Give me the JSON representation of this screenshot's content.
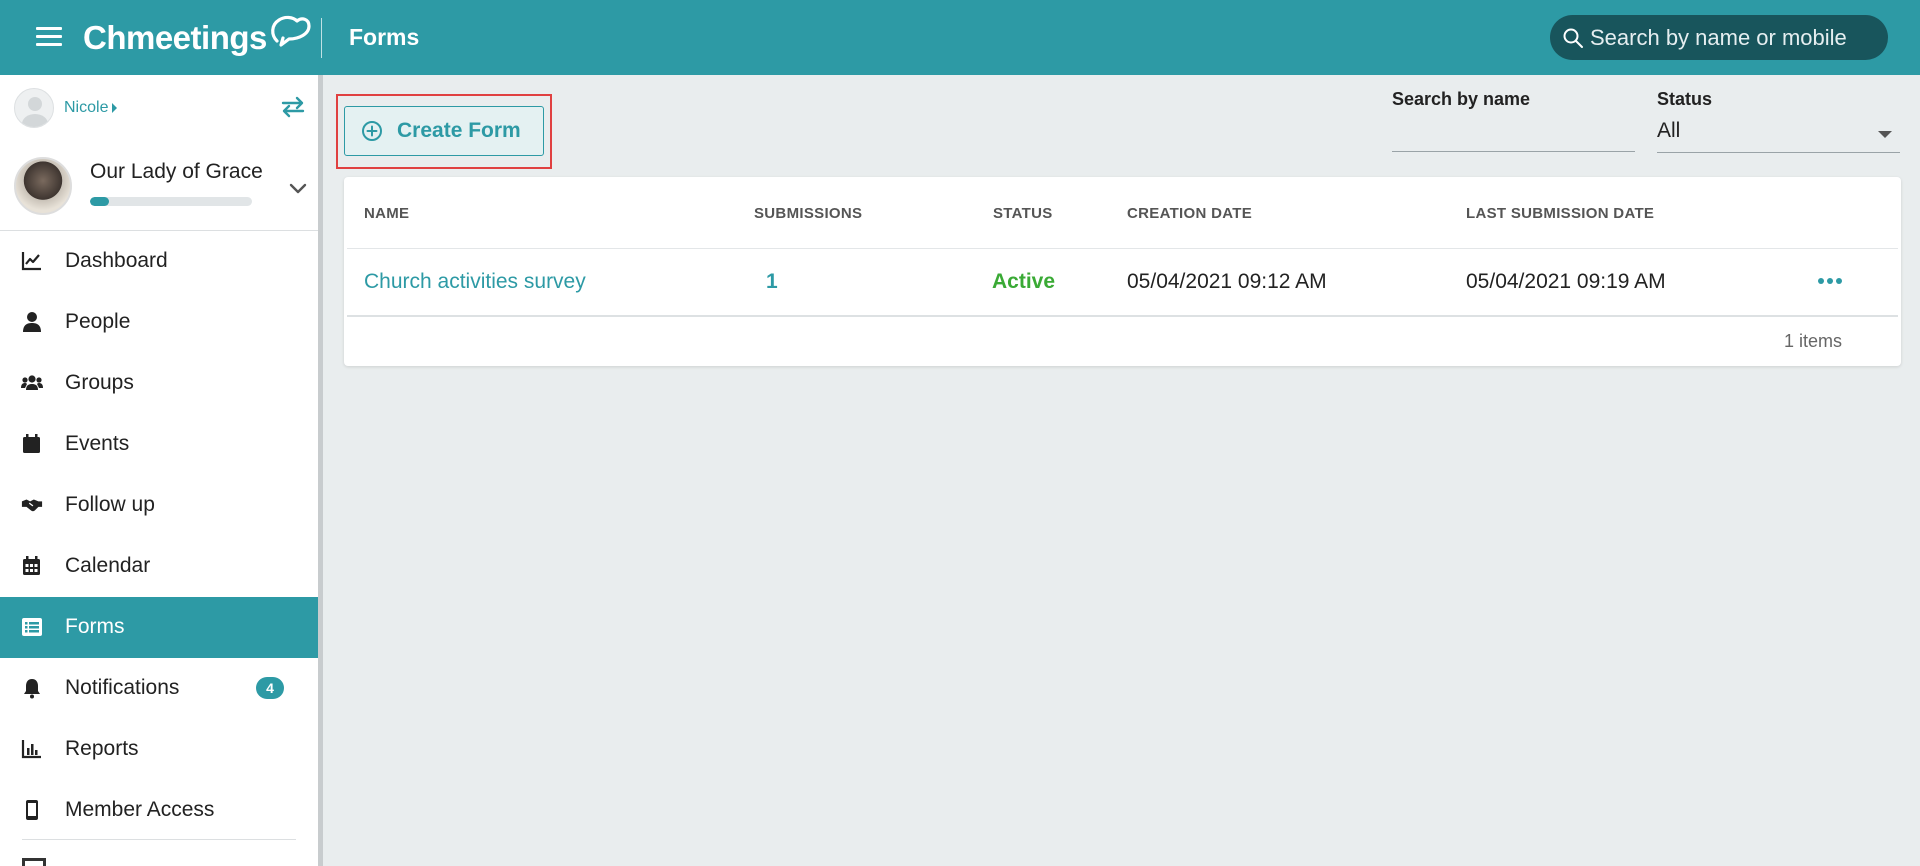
{
  "app": {
    "brand": "Chmeetings",
    "page_title": "Forms"
  },
  "global_search": {
    "placeholder": "Search by name or mobile"
  },
  "user": {
    "name": "Nicole"
  },
  "church": {
    "name": "Our Lady of Grace",
    "progress_fraction": 0.12
  },
  "sidebar": {
    "items": [
      {
        "label": "Dashboard",
        "icon": "chart-line-icon"
      },
      {
        "label": "People",
        "icon": "person-icon"
      },
      {
        "label": "Groups",
        "icon": "users-icon"
      },
      {
        "label": "Events",
        "icon": "calendar-day-icon"
      },
      {
        "label": "Follow up",
        "icon": "handshake-icon"
      },
      {
        "label": "Calendar",
        "icon": "calendar-grid-icon"
      },
      {
        "label": "Forms",
        "icon": "list-form-icon",
        "active": true
      },
      {
        "label": "Notifications",
        "icon": "bell-icon",
        "badge": "4"
      },
      {
        "label": "Reports",
        "icon": "bar-chart-icon"
      },
      {
        "label": "Member Access",
        "icon": "mobile-icon"
      }
    ]
  },
  "toolbar": {
    "create_label": "Create Form"
  },
  "filters": {
    "search_label": "Search by name",
    "search_value": "",
    "status_label": "Status",
    "status_value": "All"
  },
  "table": {
    "columns": [
      "NAME",
      "SUBMISSIONS",
      "STATUS",
      "CREATION DATE",
      "LAST SUBMISSION DATE"
    ],
    "rows": [
      {
        "name": "Church activities survey",
        "submissions": "1",
        "status": "Active",
        "creation_date": "05/04/2021 09:12 AM",
        "last_submission_date": "05/04/2021 09:19 AM"
      }
    ],
    "footer": "1 items"
  },
  "colors": {
    "primary": "#2d9aa5",
    "active_status": "#3aaa35",
    "highlight": "#e04040",
    "search_bg": "#18555c"
  }
}
